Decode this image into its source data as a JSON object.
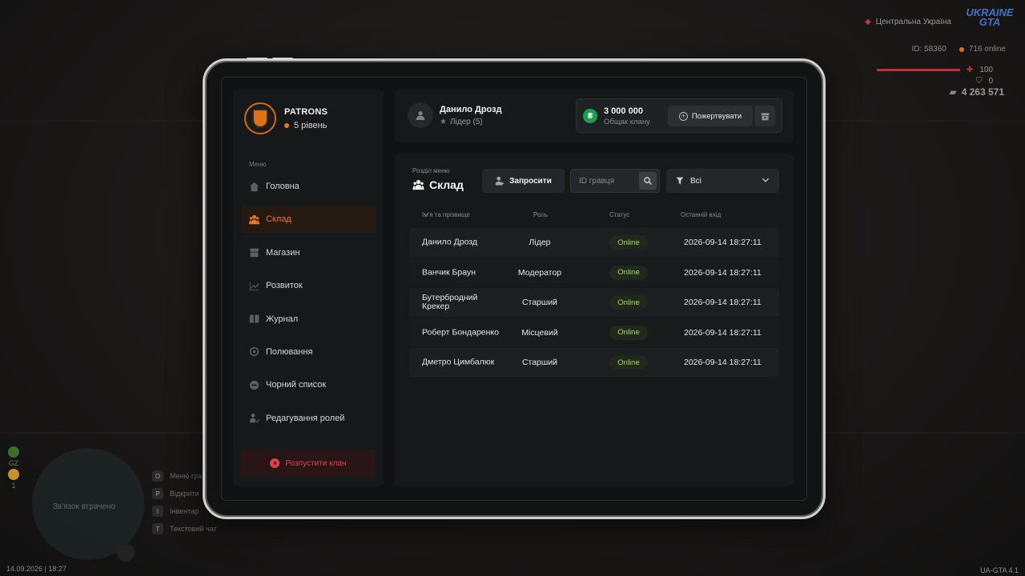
{
  "hud": {
    "region": "Центральна Україна",
    "logo": "UKRAINE GTA",
    "player_id": "ID: 58360",
    "online": "716 online",
    "health": "100",
    "armor": "0",
    "money": "4 263 571",
    "minimap_text": "Зв'язок втрачено",
    "badges": [
      "GZ",
      "1"
    ],
    "keys": [
      {
        "key": "O",
        "label": "Меню гра"
      },
      {
        "key": "P",
        "label": "Відкрити"
      },
      {
        "key": "I",
        "label": "Інвентар"
      },
      {
        "key": "T",
        "label": "Текстовий чат"
      }
    ],
    "datetime": "14.09.2026 | 18:27",
    "version": "UA-GTA 4.1"
  },
  "clan": {
    "name": "PATRONS",
    "level": "5 рівень"
  },
  "sidebar": {
    "menu_label": "Меню",
    "items": [
      {
        "label": "Головна",
        "icon": "home-icon",
        "active": false
      },
      {
        "label": "Склад",
        "icon": "people-icon",
        "active": true
      },
      {
        "label": "Магазин",
        "icon": "shop-icon",
        "active": false
      },
      {
        "label": "Розвиток",
        "icon": "chart-icon",
        "active": false
      },
      {
        "label": "Журнал",
        "icon": "book-icon",
        "active": false
      },
      {
        "label": "Полювання",
        "icon": "target-icon",
        "active": false
      },
      {
        "label": "Чорний список",
        "icon": "block-icon",
        "active": false
      },
      {
        "label": "Редагування ролей",
        "icon": "user-edit-icon",
        "active": false
      }
    ],
    "disband_label": "Розпустити клан"
  },
  "user": {
    "name": "Данило Дрозд",
    "role": "Лідер (5)"
  },
  "funds": {
    "amount": "3 000 000",
    "label": "Общак клану",
    "donate_label": "Пожертвувати"
  },
  "main": {
    "section_label": "Розділ меню",
    "section_title": "Склад",
    "invite_label": "Запросити",
    "id_placeholder": "ID гравця",
    "filter_value": "Всі",
    "columns": [
      "Ім'я та прізвище",
      "Роль",
      "Статус",
      "Останній вхід"
    ],
    "rows": [
      {
        "name": "Данило Дрозд",
        "role": "Лідер",
        "status": "Online",
        "last": "2026-09-14 18:27:11"
      },
      {
        "name": "Ванчик Браун",
        "role": "Модератор",
        "status": "Online",
        "last": "2026-09-14 18:27:11"
      },
      {
        "name": "Бутербродний Крекер",
        "role": "Старший",
        "status": "Online",
        "last": "2026-09-14 18:27:11"
      },
      {
        "name": "Роберт Бондаренко",
        "role": "Місцевий",
        "status": "Online",
        "last": "2026-09-14 18:27:11"
      },
      {
        "name": "Дметро Цимбалюк",
        "role": "Старший",
        "status": "Online",
        "last": "2026-09-14 18:27:11"
      }
    ]
  },
  "colors": {
    "accent": "#ef7a1a",
    "online": "#a7d95f",
    "danger": "#e0434d",
    "money": "#1aa04a"
  }
}
